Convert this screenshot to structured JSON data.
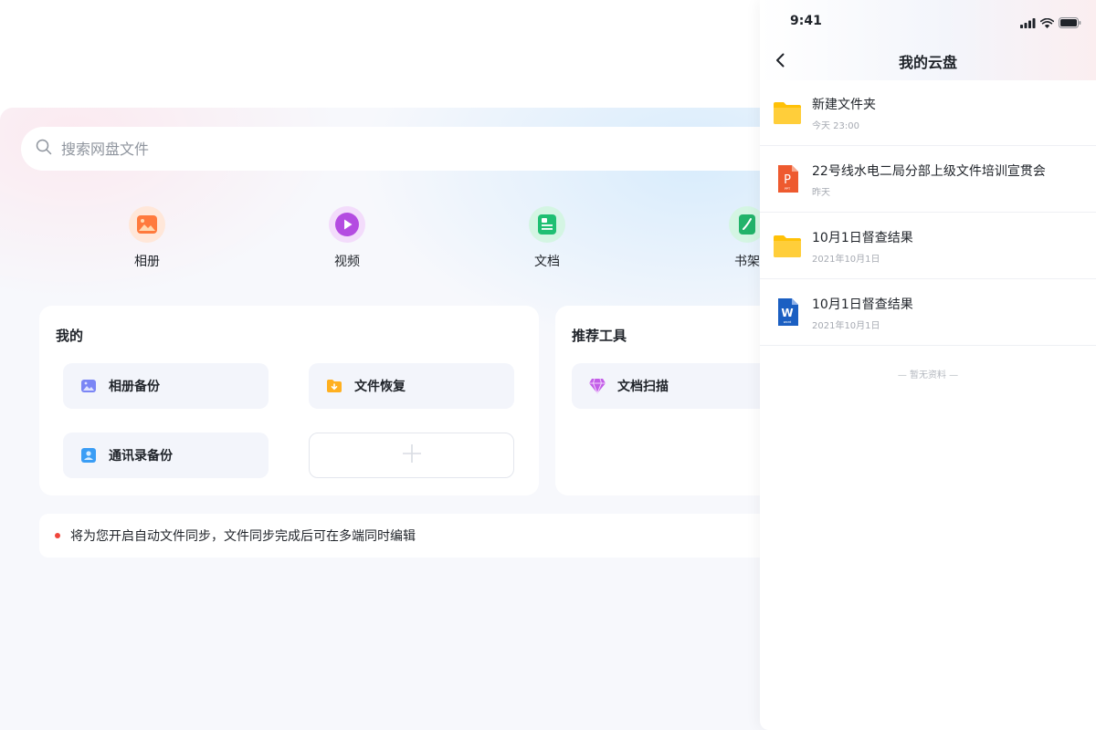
{
  "search": {
    "placeholder": "搜索网盘文件"
  },
  "quick_actions": [
    {
      "label": "相册",
      "icon": "photo-icon",
      "color": "#ff7a3d"
    },
    {
      "label": "视频",
      "icon": "play-icon",
      "color": "#b44be1"
    },
    {
      "label": "文档",
      "icon": "document-icon",
      "color": "#1fbf72"
    },
    {
      "label": "书架",
      "icon": "book-icon",
      "color": "#22b36a"
    }
  ],
  "my_section": {
    "title": "我的",
    "tiles": [
      {
        "label": "相册备份",
        "icon": "photo-backup-icon",
        "color": "#7b86f5"
      },
      {
        "label": "文件恢复",
        "icon": "file-restore-icon",
        "color": "#ffb020"
      },
      {
        "label": "通讯录备份",
        "icon": "contacts-backup-icon",
        "color": "#3a9df5"
      }
    ],
    "add_icon": "plus-icon"
  },
  "tools_section": {
    "title": "推荐工具",
    "tiles": [
      {
        "label": "文档扫描",
        "icon": "diamond-scan-icon",
        "color": "#c35ee8"
      }
    ]
  },
  "notice": {
    "text": "将为您开启自动文件同步，文件同步完成后可在多端同时编辑",
    "dot_color": "#f0463c"
  },
  "phone": {
    "status_time": "9:41",
    "title": "我的云盘",
    "files": [
      {
        "name": "新建文件夹",
        "date": "今天 23:00",
        "type": "folder"
      },
      {
        "name": "22号线水电二局分部上级文件培训宣贯会",
        "date": "昨天",
        "type": "ppt",
        "type_letter": "P",
        "type_caption": "PPT"
      },
      {
        "name": "10月1日督查结果",
        "date": "2021年10月1日",
        "type": "folder"
      },
      {
        "name": "10月1日督查结果",
        "date": "2021年10月1日",
        "type": "word",
        "type_letter": "W",
        "type_caption": "word"
      }
    ],
    "empty_text": "— 暂无资料 —"
  }
}
